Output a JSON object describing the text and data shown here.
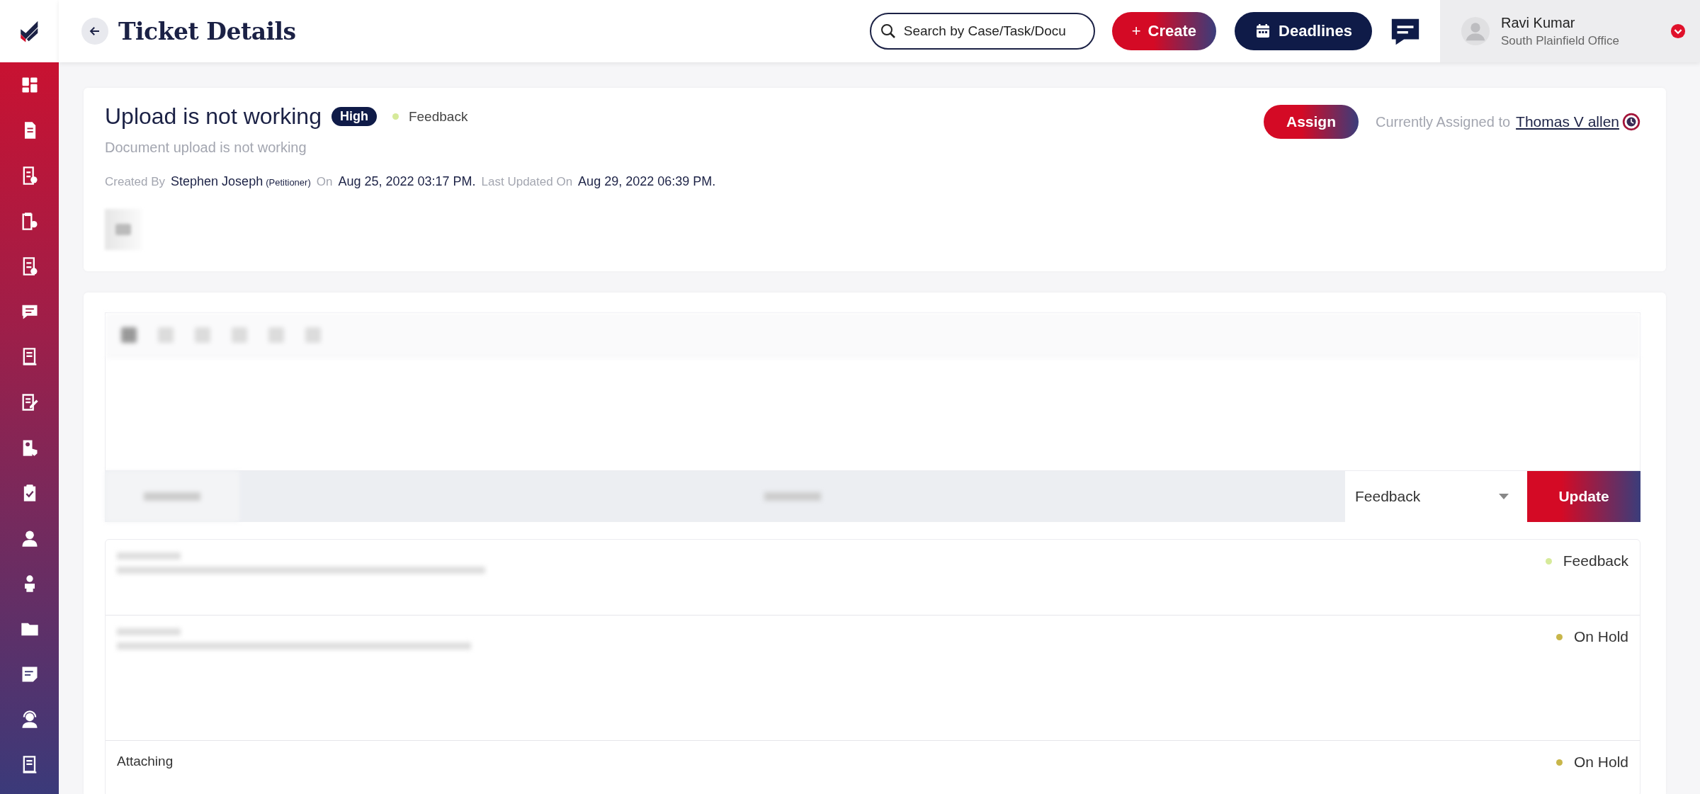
{
  "header": {
    "title": "Ticket Details"
  },
  "search": {
    "placeholder": "Search by Case/Task/Docu"
  },
  "create_button": {
    "icon": "+",
    "label": "Create"
  },
  "deadlines_button": {
    "label": "Deadlines"
  },
  "user": {
    "name": "Ravi Kumar",
    "office": "South Plainfield Office"
  },
  "ticket": {
    "title": "Upload is not working",
    "priority": "High",
    "status": {
      "label": "Feedback",
      "color": "#d6ea9a"
    },
    "description": "Document upload is not working",
    "meta": [
      {
        "kind": "label",
        "text": "Created By"
      },
      {
        "kind": "value",
        "text": "Stephen Joseph"
      },
      {
        "kind": "note",
        "text": "(Petitioner)"
      },
      {
        "kind": "label",
        "text": "On"
      },
      {
        "kind": "value",
        "text": "Aug 25, 2022 03:17 PM."
      },
      {
        "kind": "label",
        "text": "Last Updated On"
      },
      {
        "kind": "value",
        "text": "Aug 29, 2022 06:39 PM."
      }
    ]
  },
  "assign": {
    "button": "Assign",
    "label": "Currently Assigned to",
    "assignee": "Thomas V allen"
  },
  "update_bar": {
    "status_select": {
      "value": "Feedback"
    },
    "button": "Update"
  },
  "history": [
    {
      "status": "Feedback",
      "color": "#d6ea9a"
    },
    {
      "status": "On Hold",
      "color": "#c8b64a"
    },
    {
      "title": "Attaching",
      "status": "On Hold",
      "color": "#c8b64a"
    }
  ]
}
